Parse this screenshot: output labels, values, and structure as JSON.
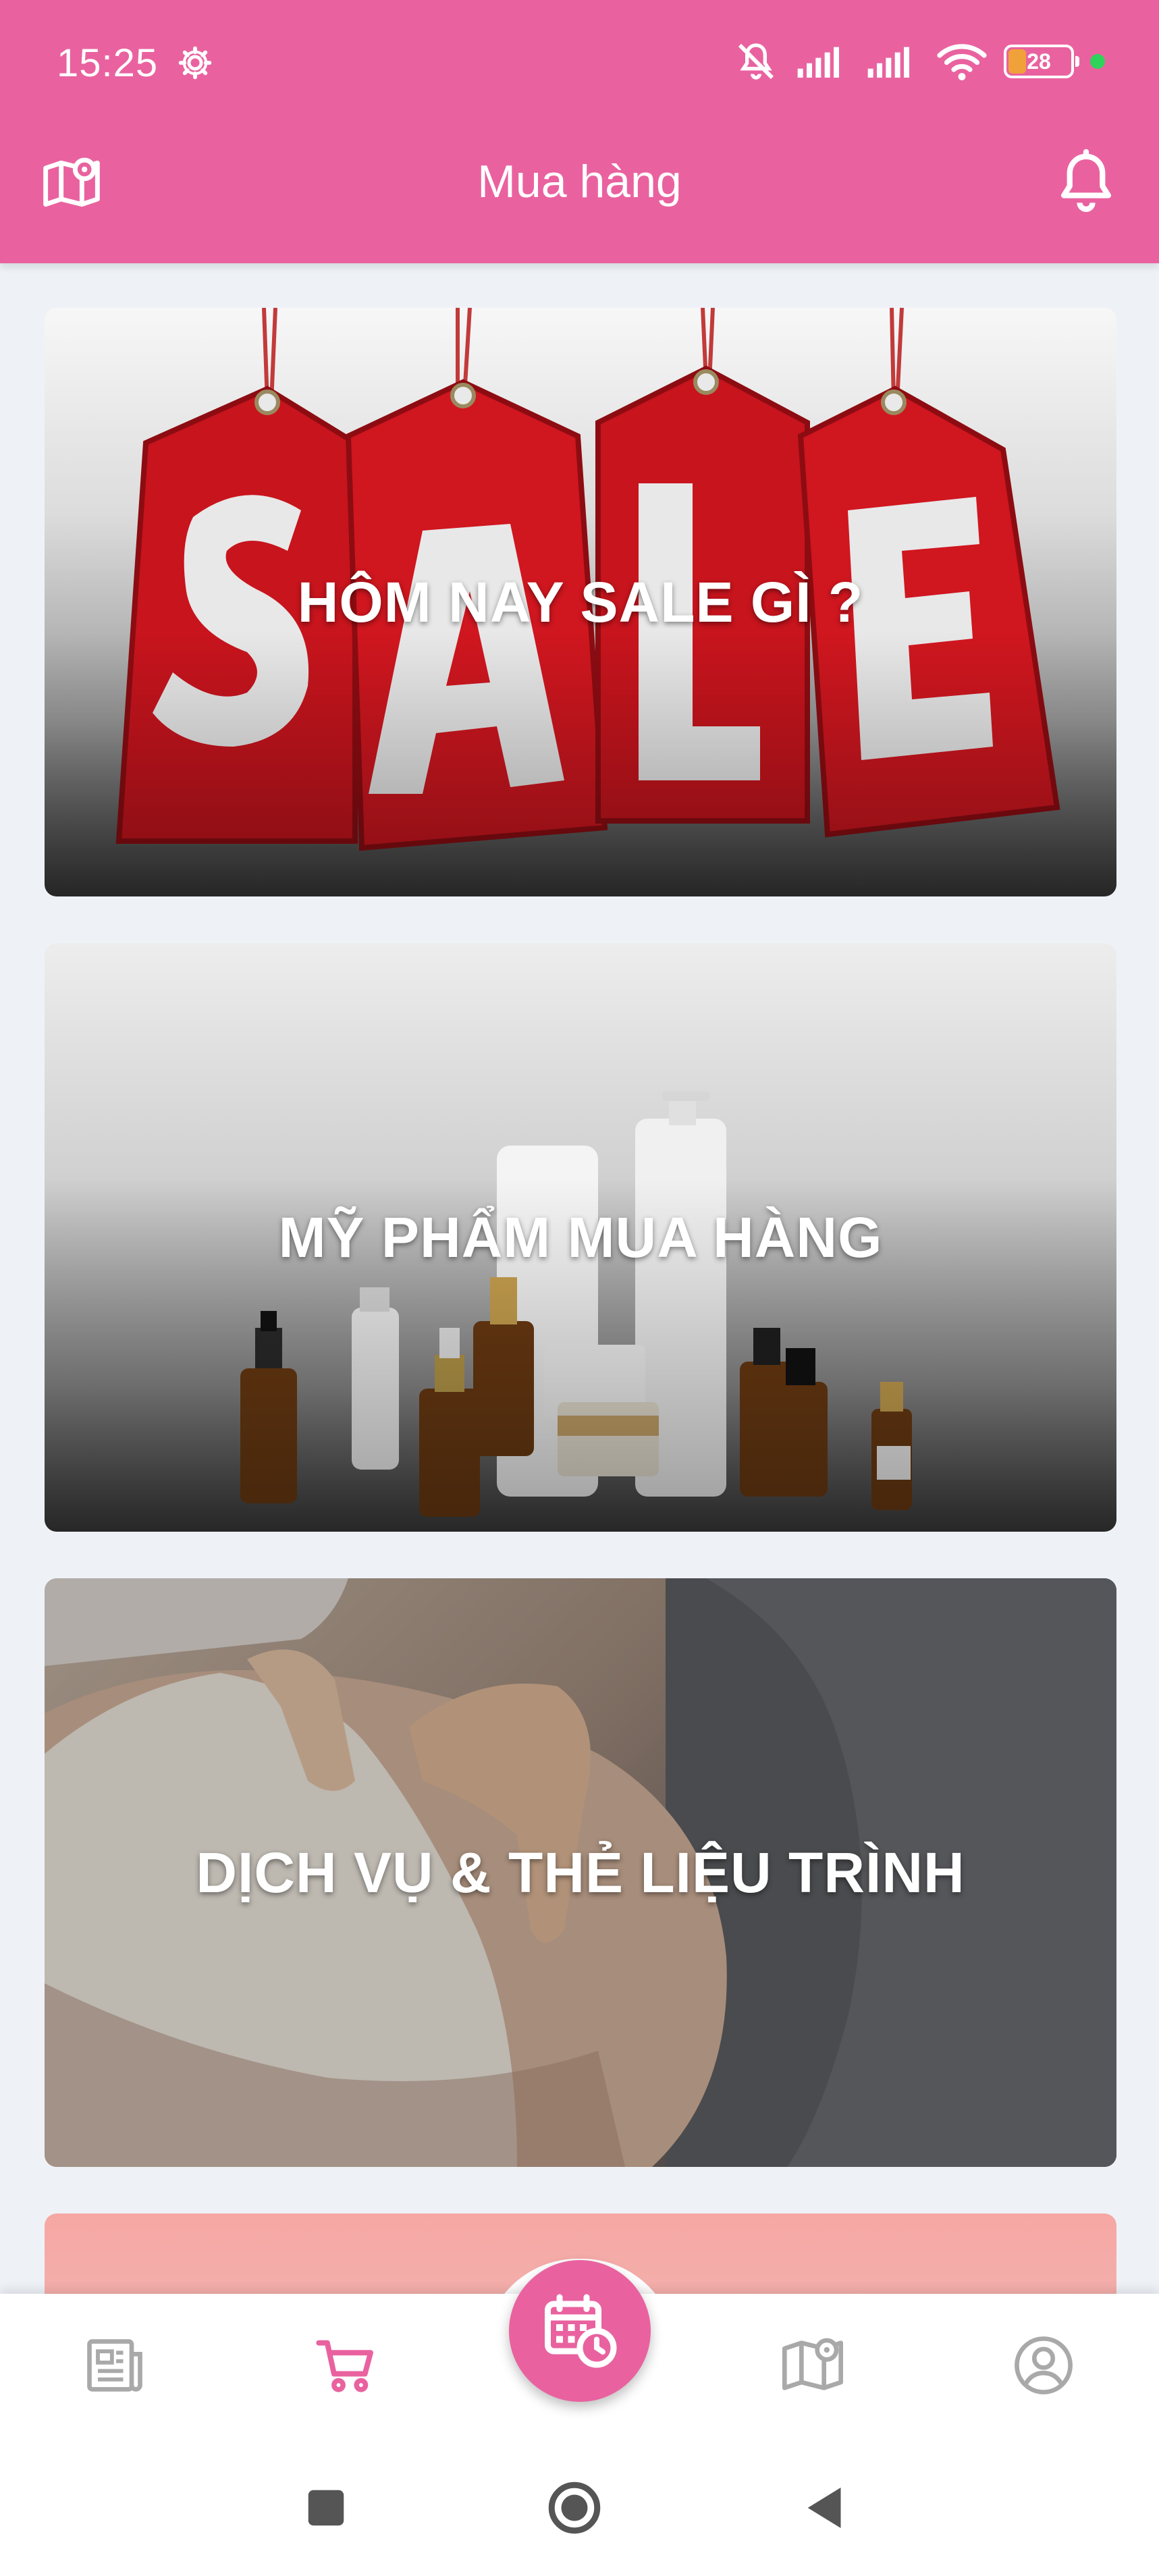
{
  "status": {
    "time": "15:25",
    "battery": "28"
  },
  "header": {
    "title": "Mua hàng"
  },
  "cards": [
    {
      "label": "HÔM NAY SALE GÌ ?"
    },
    {
      "label": "MỸ PHẨM MUA HÀNG"
    },
    {
      "label": "DỊCH VỤ & THẺ LIỆU TRÌNH"
    }
  ],
  "colors": {
    "brand_pink": "#e9629f",
    "tab_inactive": "#a9a9a9",
    "peach_card": "#f6a7a4"
  },
  "tabs": [
    {
      "icon": "newspaper-icon",
      "active": false
    },
    {
      "icon": "cart-icon",
      "active": true
    },
    {
      "icon": "calendar-clock-icon",
      "active": false,
      "center": true
    },
    {
      "icon": "map-icon",
      "active": false
    },
    {
      "icon": "user-icon",
      "active": false
    }
  ]
}
